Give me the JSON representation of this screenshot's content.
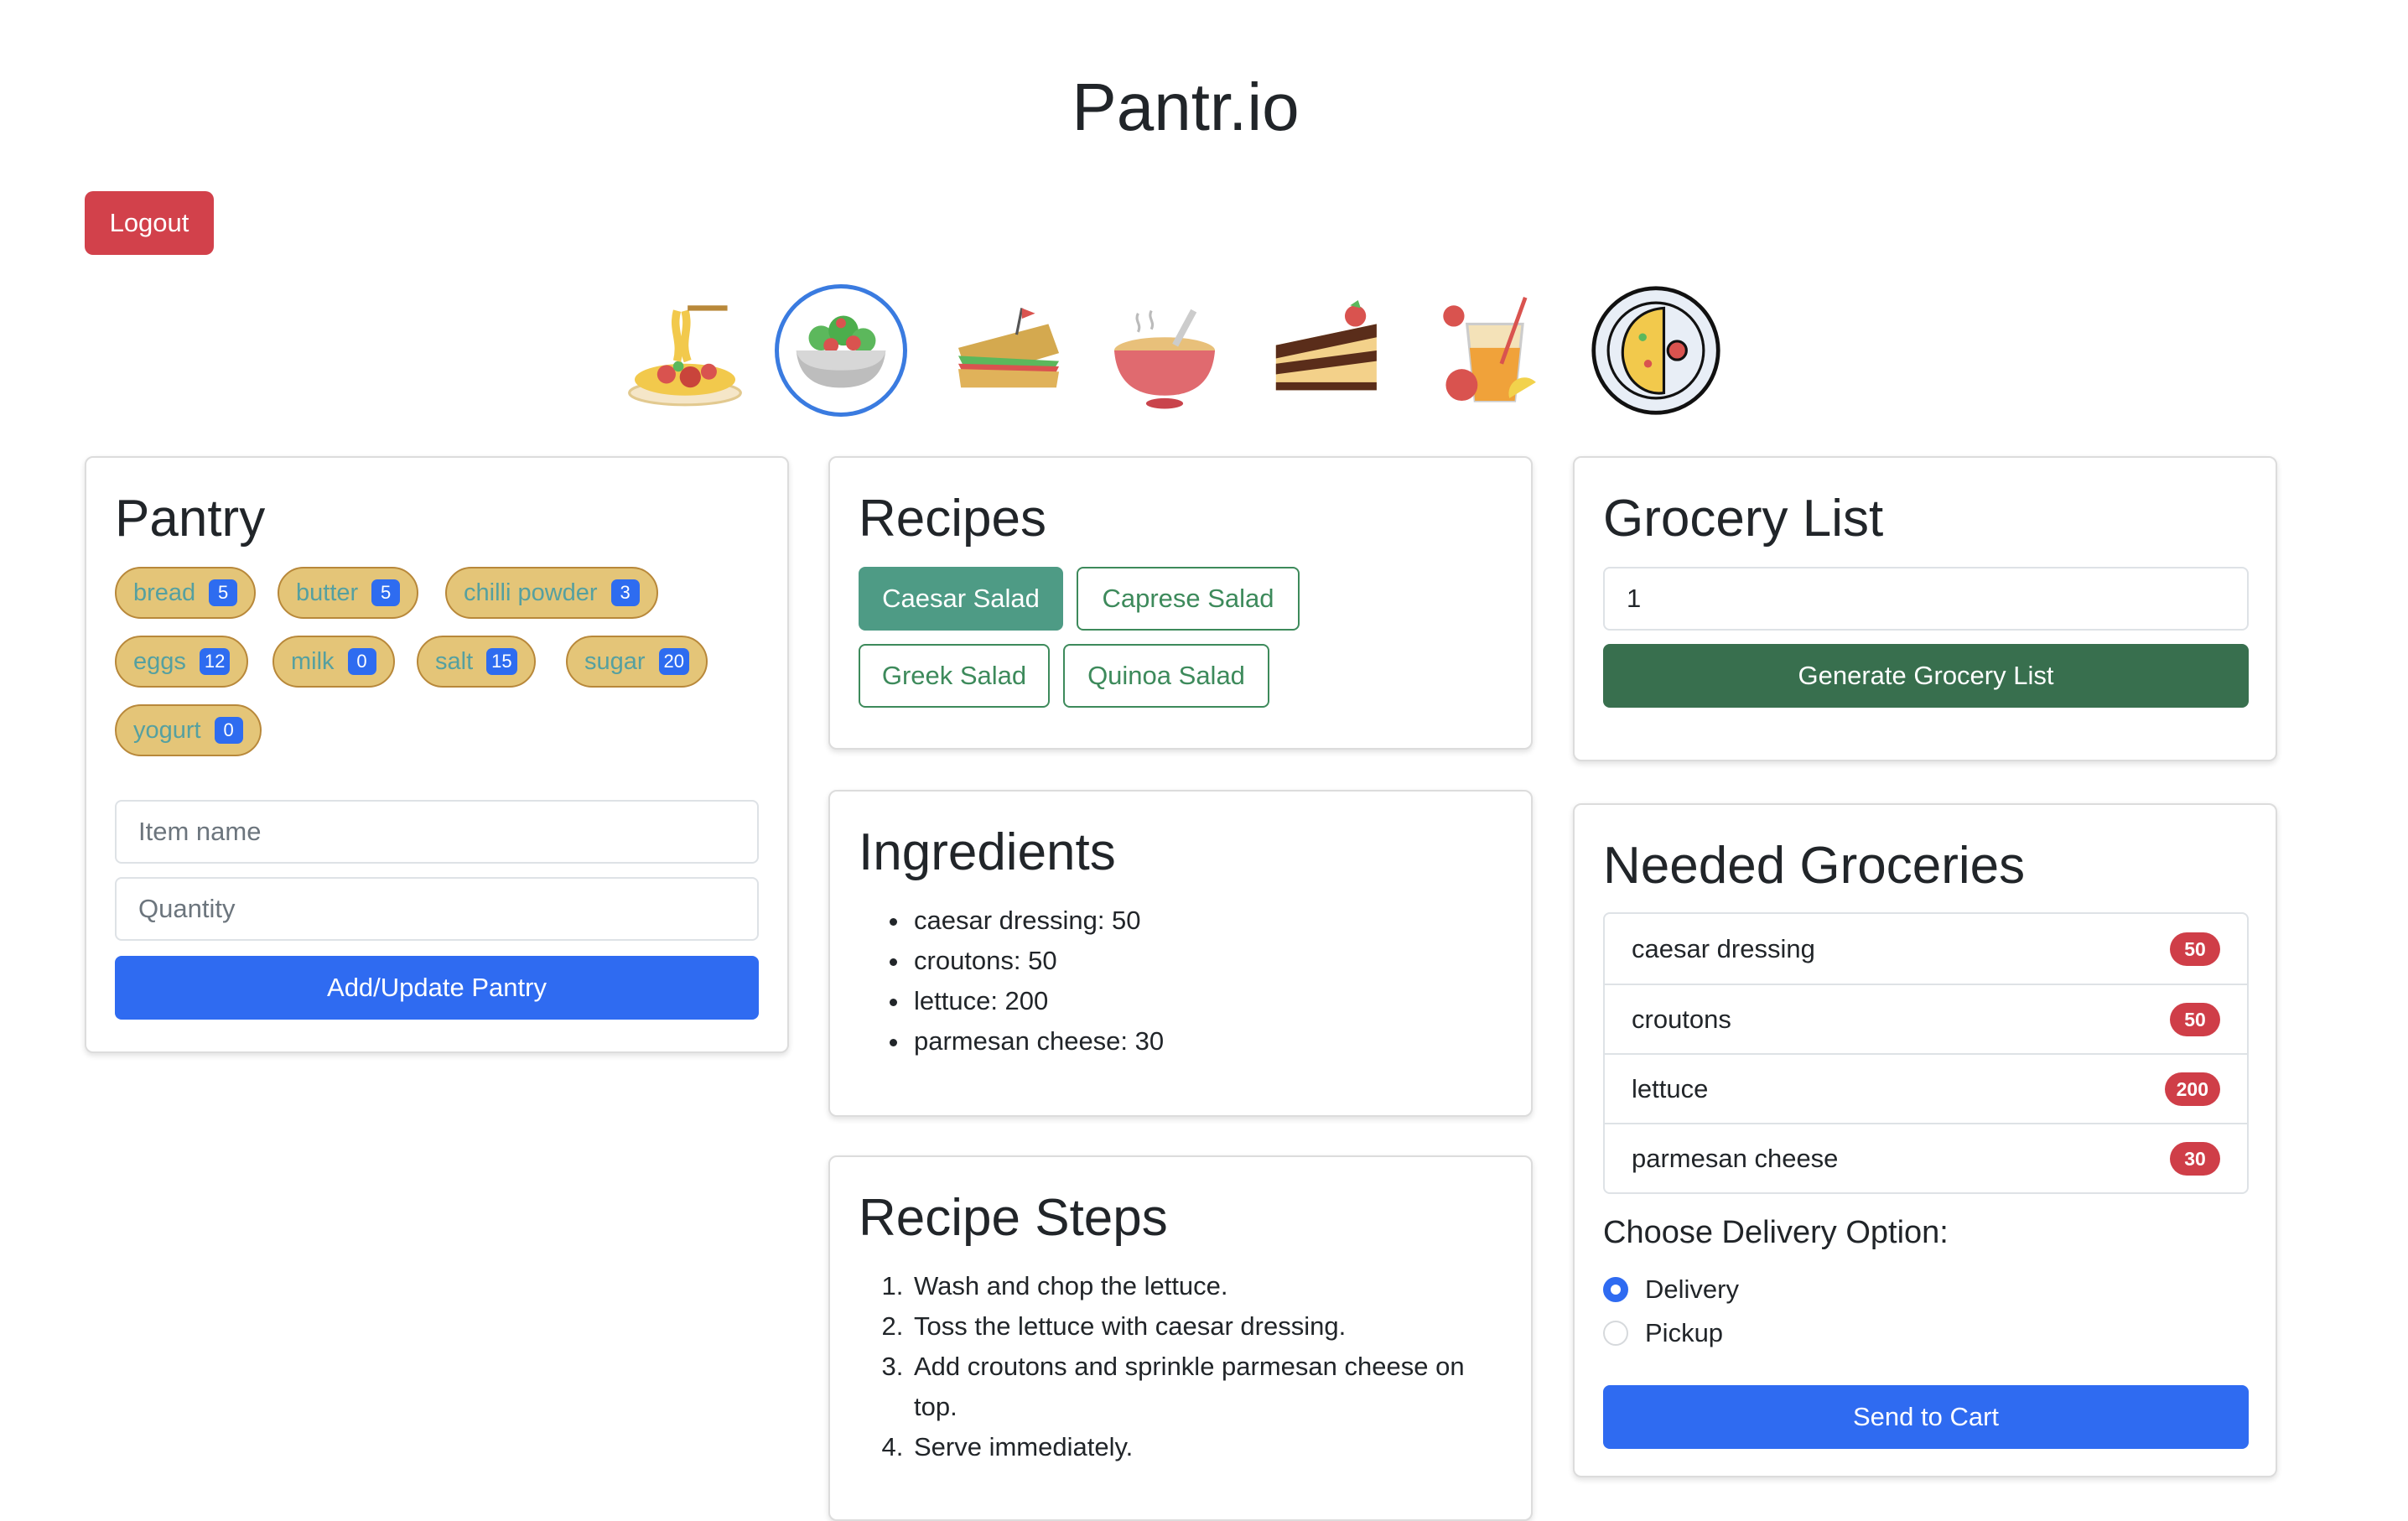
{
  "app": {
    "title": "Pantr.io",
    "logout_label": "Logout"
  },
  "categories": [
    {
      "icon": "spaghetti-icon",
      "selected": false
    },
    {
      "icon": "salad-bowl-icon",
      "selected": true
    },
    {
      "icon": "sandwich-icon",
      "selected": false
    },
    {
      "icon": "soup-bowl-icon",
      "selected": false
    },
    {
      "icon": "cake-slice-icon",
      "selected": false
    },
    {
      "icon": "juice-drink-icon",
      "selected": false
    },
    {
      "icon": "omelette-plate-icon",
      "selected": false
    }
  ],
  "pantry": {
    "title": "Pantry",
    "items": [
      {
        "name": "bread",
        "qty": "5"
      },
      {
        "name": "butter",
        "qty": "5"
      },
      {
        "name": "chilli powder",
        "qty": "3"
      },
      {
        "name": "eggs",
        "qty": "12"
      },
      {
        "name": "milk",
        "qty": "0"
      },
      {
        "name": "salt",
        "qty": "15"
      },
      {
        "name": "sugar",
        "qty": "20"
      },
      {
        "name": "yogurt",
        "qty": "0"
      }
    ],
    "item_placeholder": "Item name",
    "qty_placeholder": "Quantity",
    "submit_label": "Add/Update Pantry"
  },
  "recipes": {
    "title": "Recipes",
    "items": [
      "Caesar Salad",
      "Caprese Salad",
      "Greek Salad",
      "Quinoa Salad"
    ],
    "selected": "Caesar Salad"
  },
  "ingredients": {
    "title": "Ingredients",
    "items": [
      "caesar dressing: 50",
      "croutons: 50",
      "lettuce: 200",
      "parmesan cheese: 30"
    ]
  },
  "steps": {
    "title": "Recipe Steps",
    "items": [
      "Wash and chop the lettuce.",
      "Toss the lettuce with caesar dressing.",
      "Add croutons and sprinkle parmesan cheese on top.",
      "Serve immediately."
    ]
  },
  "grocery_list": {
    "title": "Grocery List",
    "input_value": "1",
    "generate_label": "Generate Grocery List"
  },
  "needed": {
    "title": "Needed Groceries",
    "items": [
      {
        "name": "caesar dressing",
        "qty": "50"
      },
      {
        "name": "croutons",
        "qty": "50"
      },
      {
        "name": "lettuce",
        "qty": "200"
      },
      {
        "name": "parmesan cheese",
        "qty": "30"
      }
    ],
    "delivery_heading": "Choose Delivery Option:",
    "options": [
      "Delivery",
      "Pickup"
    ],
    "selected_option": "Delivery",
    "cart_label": "Send to Cart"
  },
  "colors": {
    "danger": "#d2414b",
    "primary": "#2f6bf1",
    "success": "#386f4e",
    "chip_bg": "#e4c578",
    "recipe_active": "#4e9b85"
  }
}
